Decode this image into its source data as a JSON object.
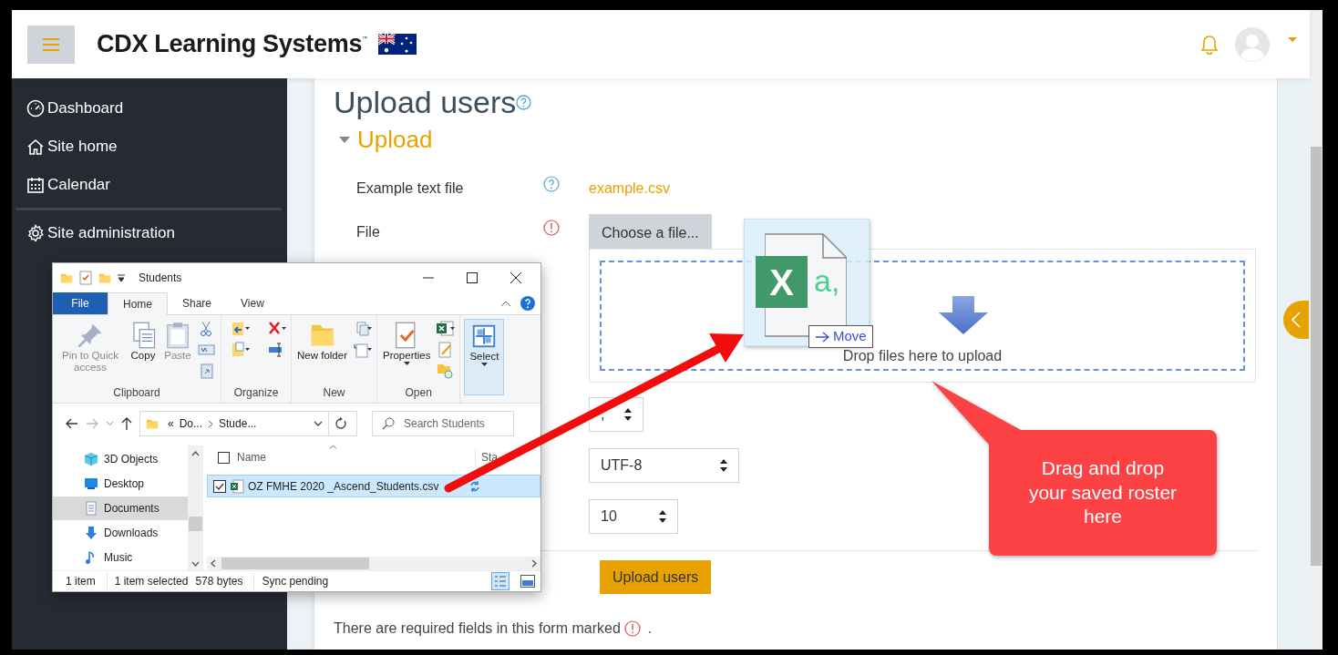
{
  "header": {
    "brand": "CDX Learning Systems$^{™}$"
  },
  "sidebar": {
    "items": [
      {
        "label": "Dashboard"
      },
      {
        "label": "Site home"
      },
      {
        "label": "Calendar"
      },
      {
        "label": "Site administration"
      }
    ]
  },
  "page": {
    "title": "Upload users",
    "section": {
      "title": "Upload",
      "expanded": true
    },
    "fields": [
      {
        "label": "Example text file",
        "required": false,
        "kind": "link",
        "value": "example.csv"
      },
      {
        "label": "File",
        "required": true,
        "kind": "file",
        "button": "Choose a file...",
        "drop_hint": "Drop files here to upload"
      }
    ],
    "selects": [
      {
        "value": ","
      },
      {
        "value": "UTF-8"
      },
      {
        "value": "10"
      }
    ],
    "submit": "Upload users",
    "note": "There are required fields in this form marked",
    "note_end": "."
  },
  "drag": {
    "icon_letter": "X",
    "icon_text": "a,",
    "badge": "Move"
  },
  "callout": {
    "text": "Drag and drop your saved roster here"
  },
  "explorer": {
    "title": "Students",
    "tabs": [
      {
        "label": "File",
        "kind": "menu",
        "selected": false
      },
      {
        "label": "Home",
        "kind": "tab",
        "selected": true
      },
      {
        "label": "Share",
        "kind": "tab",
        "selected": false
      },
      {
        "label": "View",
        "kind": "tab",
        "selected": false
      }
    ],
    "groups": [
      {
        "name": "Clipboard",
        "buttons": [
          {
            "label": "Pin to Quick access",
            "disabled": true
          },
          {
            "label": "Copy",
            "disabled": false
          },
          {
            "label": "Paste",
            "disabled": true
          }
        ]
      },
      {
        "name": "Organize"
      },
      {
        "name": "New",
        "buttons": [
          {
            "label": "New folder",
            "disabled": false
          }
        ]
      },
      {
        "name": "Open",
        "buttons": [
          {
            "label": "Properties",
            "disabled": false
          }
        ]
      },
      {
        "buttons": [
          {
            "label": "Select",
            "disabled": false
          }
        ]
      }
    ],
    "address": {
      "overflow": "«",
      "parts": [
        "Do...",
        "Stude..."
      ]
    },
    "search": {
      "placeholder": "Search Students"
    },
    "nav": [
      {
        "label": "3D Objects",
        "selected": false
      },
      {
        "label": "Desktop",
        "selected": false
      },
      {
        "label": "Documents",
        "selected": true
      },
      {
        "label": "Downloads",
        "selected": false
      },
      {
        "label": "Music",
        "selected": false
      }
    ],
    "select_all_checked": false,
    "columns": [
      "Name",
      "Sta"
    ],
    "files": [
      {
        "name": "OZ FMHE 2020 _Ascend_Students.csv",
        "selected": true,
        "checked": true
      }
    ],
    "status": [
      "1 item",
      "1 item selected",
      "578 bytes",
      "Sync pending"
    ]
  }
}
